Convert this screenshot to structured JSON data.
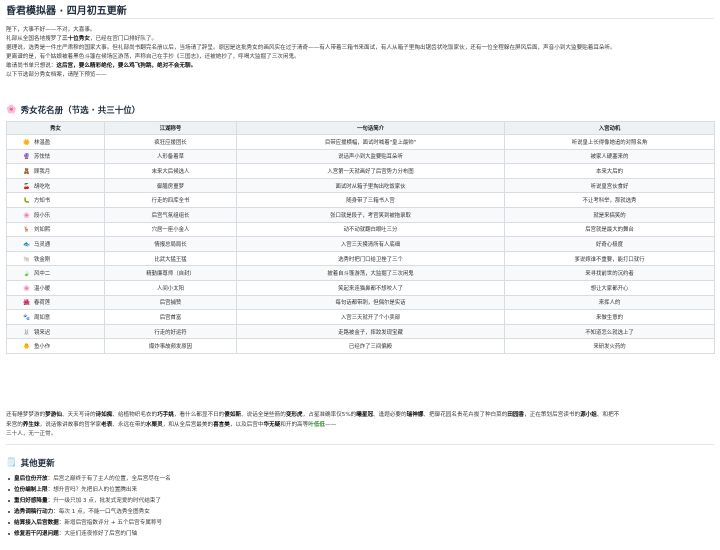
{
  "title": "昏君模拟器 · 四月初五更新",
  "intro": {
    "lines": [
      [
        {
          "t": "陛下，大事不好——不对，大喜事。"
        }
      ],
      [
        {
          "t": "礼部从全国各地搜罗了"
        },
        {
          "t": "三十位秀女",
          "b": true
        },
        {
          "t": "，已经在宫门口排好队了。"
        }
      ],
      [
        {
          "t": "据理说，选秀是一件庄严肃穆的国家大事。但礼部尚书翻完名册以后，当场请了辞呈。原因是这批秀女的画风实在过于清奇——有人带着三箱书来面试，有人从箱子里掏出锯齿状吃饭家伙，还有一位全程躲在屏风后面，声音小到大监要贴着耳朵听。"
        }
      ],
      [
        {
          "t": "更离谱的是，有个姑娘被着黑色斗篷在候场区游荡，声称自己在手抄《三国志》，还被她抄了，呼喝大监掘了三次闲鬼。"
        }
      ],
      [
        {
          "t": "敢请尚书单只想说："
        },
        {
          "t": "这后宫，要么精彩绝伦，要么鸡飞狗跳，绝对不会无聊。",
          "b": true
        }
      ],
      [
        {
          "t": "以下节选部分秀女档案，请陛下预览——"
        }
      ]
    ]
  },
  "roster": {
    "icon": "flower-icon",
    "heading": "秀女花名册（节选 · 共三十位）",
    "columns": [
      "秀女",
      "江湖称号",
      "一句话简介",
      "入宫动机"
    ],
    "rows": [
      {
        "avatar": "🌼",
        "name": "林温盈",
        "title": "疯狂应援团长",
        "intro": "目带应援横幅，面试时喊着\"皇上最帅\"",
        "motive": "听说皇上长得像她追的对照名角"
      },
      {
        "avatar": "🔮",
        "name": "苏怯怯",
        "title": "人形备着草",
        "intro": "说话声小到大监要贴耳朵听",
        "motive": "被家人硬塞来的"
      },
      {
        "avatar": "🧸",
        "name": "顾我月",
        "title": "末来大后候选人",
        "intro": "入宫第一天就画好了后宫势力分布图",
        "motive": "本来大后的"
      },
      {
        "avatar": "🍒",
        "name": "胡吃吃",
        "title": "御膳房噩梦",
        "intro": "面试时从箱子里掏出吃饭家伙",
        "motive": "听说皇宫伙食好"
      },
      {
        "avatar": "🐛",
        "name": "方知书",
        "title": "行走的四库全书",
        "intro": "随身带了三箱书入宫",
        "motive": "不让考科举，那就选秀"
      },
      {
        "avatar": "🌸",
        "name": "段小乐",
        "title": "后宫气氛组组长",
        "intro": "张口就是段子，考官笑到被拖录取",
        "motive": "就是来搞笑的"
      },
      {
        "avatar": "🦌",
        "name": "刘如熙",
        "title": "穴居一座小金人",
        "intro": "动不动就翻白眼吐三分",
        "motive": "后宫就是最大的舞台"
      },
      {
        "avatar": "🐟",
        "name": "马灵通",
        "title": "情报总局局长",
        "intro": "入宫三天摸清所有人底细",
        "motive": "好奇心极度"
      },
      {
        "avatar": "🐚",
        "name": "铁金刚",
        "title": "比武大猛王猛",
        "intro": "选秀时把门口给卫挫了三个",
        "motive": "爹说嫁谁不重要，能打口就行"
      },
      {
        "avatar": "🍃",
        "name": "风中二",
        "title": "精勤廉尊师（自封）",
        "intro": "披着自斗篷游荡，大监掘了三次闲鬼",
        "motive": "来寻找前世的沉约者"
      },
      {
        "avatar": "🌸",
        "name": "温小暖",
        "title": "人间小太阳",
        "intro": "笑起来连猫鼻都不想咬人了",
        "motive": "想让大家都开心"
      },
      {
        "avatar": "🌺",
        "name": "春荷莲",
        "title": "后宫捕赞",
        "intro": "每句话都带刺，但偶尔是实话",
        "motive": "来挥人的"
      },
      {
        "avatar": "🐾",
        "name": "周如意",
        "title": "后宫首富",
        "intro": "入宫三天就开了个小卖部",
        "motive": "来做生意的"
      },
      {
        "avatar": "🐰",
        "name": "镜来迟",
        "title": "行走的好运符",
        "intro": "走路被金子，摔跤发现宝藏",
        "motive": "不知道怎么就选上了"
      },
      {
        "avatar": "🐥",
        "name": "鱼小作",
        "title": "爆炸事故频发原因",
        "intro": "已经炸了三间偏殿",
        "motive": "来研发火药的"
      }
    ]
  },
  "summary": {
    "lines": [
      [
        {
          "t": "还有睡梦梦游的"
        },
        {
          "t": "梦游仙",
          "b": true
        },
        {
          "t": "、天天写诗的"
        },
        {
          "t": "诗如痴",
          "b": true
        },
        {
          "t": "、给植物织毛衣的"
        },
        {
          "t": "巧手姚",
          "b": true
        },
        {
          "t": "，看什么都显不日的"
        },
        {
          "t": "傻如斯",
          "b": true
        },
        {
          "t": "、说话全是些箭的"
        },
        {
          "t": "变形虎",
          "b": true
        },
        {
          "t": "，占星准确率仅5%的"
        },
        {
          "t": "曦星冠",
          "b": true
        },
        {
          "t": "、逢题必要的"
        },
        {
          "t": "瑞神娜",
          "b": true
        },
        {
          "t": "、把御花园名贵花卉拔了种白菜的"
        },
        {
          "t": "田园香",
          "b": true
        },
        {
          "t": "，正在策划后宫读书的"
        },
        {
          "t": "源小姐",
          "b": true
        },
        {
          "t": "、和把不"
        }
      ],
      [
        {
          "t": "来宫的"
        },
        {
          "t": "养生妹",
          "b": true
        },
        {
          "t": "，说话像讲故事的哲学家"
        },
        {
          "t": "老表",
          "b": true
        },
        {
          "t": "、永远在带的"
        },
        {
          "t": "水栗灵",
          "b": true
        },
        {
          "t": "，和从全后宫最美的"
        },
        {
          "t": "喜言美",
          "b": true
        },
        {
          "t": "，以及后宫中"
        },
        {
          "t": "华无疑",
          "b": true
        },
        {
          "t": "和开的高等"
        },
        {
          "t": "叶低低",
          "g": true
        },
        {
          "t": "——"
        }
      ],
      [
        {
          "t": "三十人，无一正常。"
        }
      ]
    ]
  },
  "updates": {
    "icon": "document-icon",
    "heading": "其他更新",
    "items": [
      {
        "key": "皇后位份开放",
        "desc": "后宫之巅终于有了主人的位置，全后宫尽在一名"
      },
      {
        "key": "位份编制上限",
        "desc": "想升官吗？先把旧人的位置腾出来"
      },
      {
        "key": "重归好感降量",
        "desc": "升一级只加 3 点，批发式宠爱的时代结束了"
      },
      {
        "key": "选秀调稿行动力",
        "desc": "每次 1 点，不能一口气选秀全图秀女"
      },
      {
        "key": "结算接入后宫数据",
        "desc": "新增后宫指数评分 + 五个后宫专属称号"
      },
      {
        "key": "修复若干闪退问题",
        "desc": "大臣们连夜修好了后宫的门轴"
      }
    ]
  }
}
